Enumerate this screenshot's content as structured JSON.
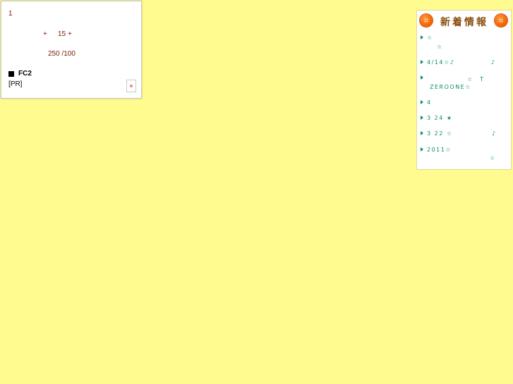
{
  "ad": {
    "number": "1",
    "plus_a": "+",
    "count": "15",
    "plus_b": "+",
    "score": "250 /100",
    "fc2_label": "FC2",
    "pr_label": "[PR]",
    "close_label": "×"
  },
  "news": {
    "title": "新着情報",
    "accent_color": "#f06000",
    "text_color": "#0e8f5a",
    "items": [
      {
        "line1": "☆",
        "line2": "☆"
      },
      {
        "line1": "4/14☆♪",
        "line1b": "♪"
      },
      {
        "line1": "☆　T",
        "line2": "ZEROONE☆"
      },
      {
        "line1": "4"
      },
      {
        "line1": "3 24 ★"
      },
      {
        "line1": "3 22 ☆",
        "line1b": "♪"
      },
      {
        "line1": "2011☆",
        "line2": "☆"
      }
    ]
  }
}
